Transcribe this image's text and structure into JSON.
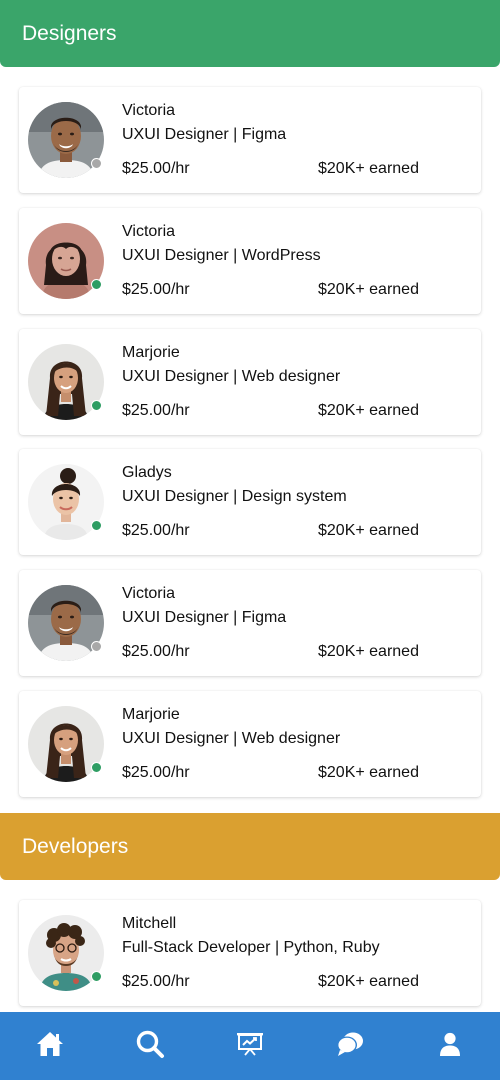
{
  "colors": {
    "designers_header": "#3aa56a",
    "developers_header": "#daa030",
    "nav_bar": "#3081d0",
    "online": "#2e9d63",
    "offline": "#a8a8a8"
  },
  "sections": [
    {
      "key": "designers",
      "title": "Designers",
      "cards": [
        {
          "name": "Victoria",
          "role": "UXUI Designer | Figma",
          "rate": "$25.00/hr",
          "earned": "$20K+ earned",
          "status": "offline",
          "avatar": "man-beard"
        },
        {
          "name": "Victoria",
          "role": "UXUI Designer | WordPress",
          "rate": "$25.00/hr",
          "earned": "$20K+ earned",
          "status": "online",
          "avatar": "woman-bangs"
        },
        {
          "name": "Marjorie",
          "role": "UXUI Designer | Web designer",
          "rate": "$25.00/hr",
          "earned": "$20K+ earned",
          "status": "online",
          "avatar": "woman-longhair"
        },
        {
          "name": "Gladys",
          "role": "UXUI Designer | Design system",
          "rate": "$25.00/hr",
          "earned": "$20K+ earned",
          "status": "online",
          "avatar": "woman-bun"
        },
        {
          "name": "Victoria",
          "role": "UXUI Designer | Figma",
          "rate": "$25.00/hr",
          "earned": "$20K+ earned",
          "status": "offline",
          "avatar": "man-beard"
        },
        {
          "name": "Marjorie",
          "role": "UXUI Designer | Web designer",
          "rate": "$25.00/hr",
          "earned": "$20K+ earned",
          "status": "online",
          "avatar": "woman-longhair"
        }
      ]
    },
    {
      "key": "developers",
      "title": "Developers",
      "cards": [
        {
          "name": "Mitchell",
          "role": "Full-Stack Developer | Python, Ruby",
          "rate": "$25.00/hr",
          "earned": "$20K+ earned",
          "status": "online",
          "avatar": "man-curly"
        }
      ]
    }
  ],
  "nav": {
    "items": [
      {
        "key": "home",
        "icon": "home-icon"
      },
      {
        "key": "search",
        "icon": "search-icon"
      },
      {
        "key": "dashboard",
        "icon": "presentation-chart-icon"
      },
      {
        "key": "messages",
        "icon": "chat-bubbles-icon"
      },
      {
        "key": "profile",
        "icon": "user-icon"
      }
    ]
  }
}
